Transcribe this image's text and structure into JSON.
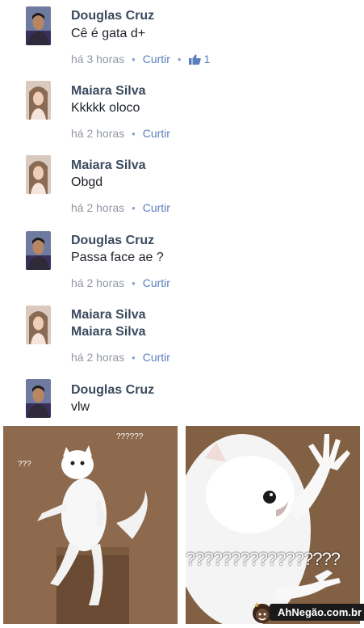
{
  "comments": [
    {
      "author": "Douglas Cruz",
      "text": "Cê é gata d+",
      "time": "há 3 horas",
      "like_label": "Curtir",
      "likes": "1",
      "avatar": "douglas"
    },
    {
      "author": "Maiara Silva",
      "text": "Kkkkk oloco",
      "time": "há 2 horas",
      "like_label": "Curtir",
      "avatar": "maiara"
    },
    {
      "author": "Maiara Silva",
      "text": "Obgd",
      "time": "há 2 horas",
      "like_label": "Curtir",
      "avatar": "maiara"
    },
    {
      "author": "Douglas Cruz",
      "text": "Passa face ae ?",
      "time": "há 2 horas",
      "like_label": "Curtir",
      "avatar": "douglas"
    },
    {
      "author": "Maiara Silva",
      "text": "Maiara Silva",
      "time": "há 2 horas",
      "like_label": "Curtir",
      "avatar": "maiara"
    },
    {
      "author": "Douglas Cruz",
      "text": "vlw",
      "avatar": "douglas"
    }
  ],
  "meme": {
    "caption_left_1": "???",
    "caption_left_2": "??????",
    "caption_right": "?????????????????",
    "watermark": "AhNegão.com.br"
  },
  "colors": {
    "name": "#3b4a5e",
    "meta": "#9197a3",
    "link": "#5b7fbd"
  },
  "icons": {
    "like": "thumbs-up-icon"
  }
}
